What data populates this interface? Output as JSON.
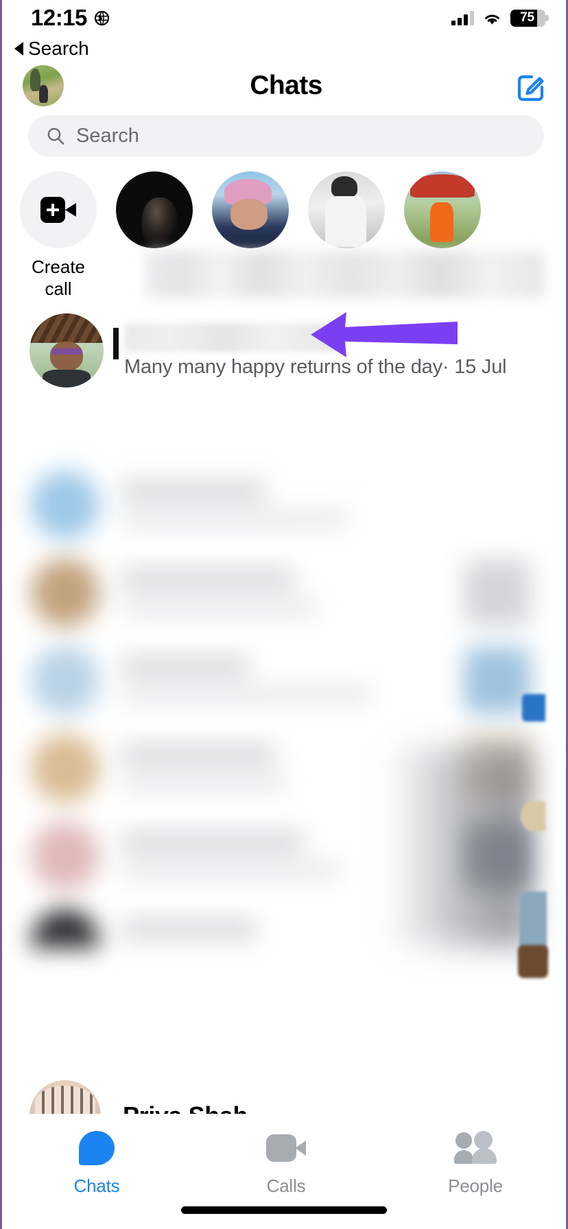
{
  "status_bar": {
    "time": "12:15",
    "location_icon": "location-services-icon",
    "signal_icon": "cellular-signal-icon",
    "wifi_icon": "wifi-icon",
    "battery_percent": "75"
  },
  "back_nav": {
    "label": "Search",
    "icon": "back-triangle-icon"
  },
  "header": {
    "title": "Chats",
    "avatar": "user-profile-avatar",
    "compose_icon": "compose-new-message-icon"
  },
  "search": {
    "placeholder": "Search",
    "value": "",
    "icon": "search-icon"
  },
  "story_row": {
    "create_call": {
      "label_line1": "Create",
      "label_line2": "call",
      "icon": "video-camera-plus-icon"
    },
    "contacts": [
      {
        "name": "",
        "avatar": "contact-avatar-1"
      },
      {
        "name": "",
        "avatar": "contact-avatar-2"
      },
      {
        "name": "",
        "avatar": "contact-avatar-3"
      },
      {
        "name": "",
        "avatar": "contact-avatar-4"
      }
    ],
    "names_blurred": true
  },
  "highlighted_chat": {
    "name": "",
    "name_blurred": true,
    "preview": "Many many happy returns of the day· 15 Jul",
    "avatar": "chat-contact-avatar"
  },
  "annotation": {
    "type": "arrow-left",
    "color": "#7b3ff2"
  },
  "chat_list": {
    "blurred": true,
    "rows": 6
  },
  "last_visible_chat": {
    "name": "Priya Shah",
    "avatar": "priya-shah-avatar"
  },
  "tab_bar": {
    "active": "Chats",
    "tabs": [
      {
        "label": "Chats",
        "icon": "chat-bubble-icon"
      },
      {
        "label": "Calls",
        "icon": "video-camera-icon"
      },
      {
        "label": "People",
        "icon": "people-icon"
      }
    ],
    "active_color": "#1b84f2",
    "inactive_color": "#8e8e93"
  },
  "home_indicator": "home-indicator-bar"
}
